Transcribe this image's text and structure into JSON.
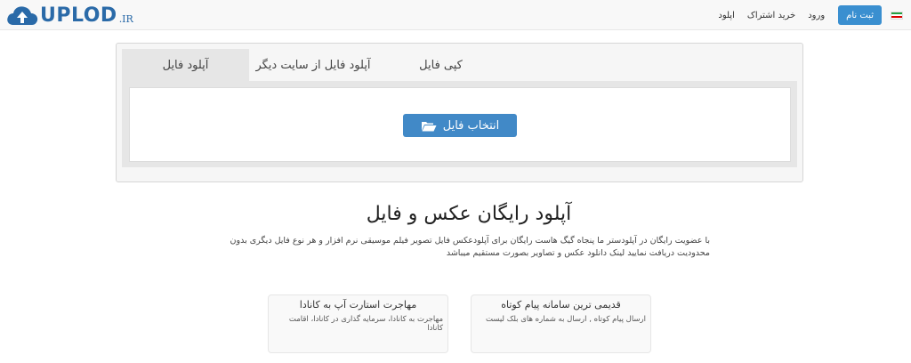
{
  "logo": {
    "name": "UPLOD",
    "tld": ".IR"
  },
  "nav": {
    "flag": "iran-flag",
    "signup_label": "ثبت نام",
    "login_label": "ورود",
    "subscribe_label": "خرید اشتراک",
    "upload_label": "اپلود"
  },
  "panel": {
    "tabs": [
      {
        "label": "آپلود فایل",
        "active": true
      },
      {
        "label": "آپلود فایل از سایت دیگر",
        "active": false
      },
      {
        "label": "کپی فایل",
        "active": false
      }
    ],
    "select_button_label": "انتخاب فایل",
    "select_button_icon": "folder-open-icon"
  },
  "hero": {
    "title": "آپلود رایگان عکس و فایل",
    "description": "با عضویت رایگان در آپلودستر ما پنجاه گیگ هاست رایگان برای آپلودعکس فایل تصویر فیلم موسیقی نرم افزار و هر نوع فایل دیگری بدون محدودیت دریافت نمایید لینک دانلود عکس و تصاویر بصورت مستقیم میباشد"
  },
  "cards": [
    {
      "title": "قدیمی ترین سامانه پیام کوتاه",
      "text": "ارسال پیام کوتاه , ارسال به شماره های بلک لیست"
    },
    {
      "title": "مهاجرت استارت آپ به کانادا",
      "text": "مهاجرت به کانادا، سرمایه گذاری در کانادا، اقامت کانادا"
    }
  ],
  "colors": {
    "primary": "#4189c7",
    "brand": "#2a6aa8"
  }
}
